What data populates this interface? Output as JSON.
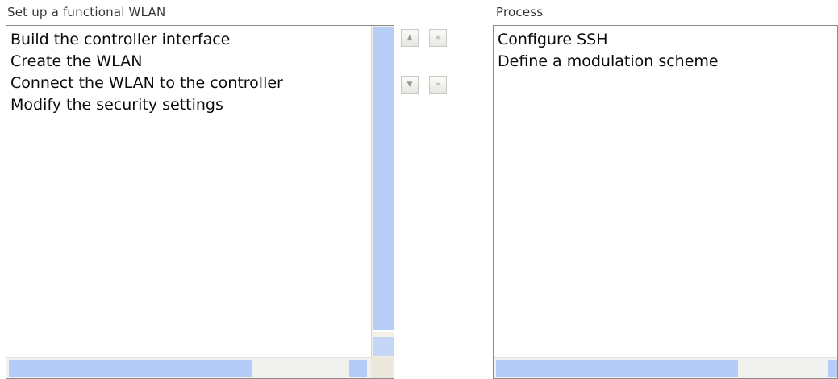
{
  "left_panel": {
    "caption": "Set up a functional WLAN",
    "items": [
      "Build the controller interface",
      "Create the WLAN",
      "Connect the WLAN to the controller",
      "Modify the security settings"
    ]
  },
  "right_panel": {
    "caption": "Process",
    "items": [
      "Configure SSH",
      "Define a modulation scheme"
    ]
  },
  "controls": {
    "move_up_icon": "▲",
    "move_to_left_icon": "«",
    "move_down_icon": "▼",
    "move_to_right_icon": "»"
  }
}
